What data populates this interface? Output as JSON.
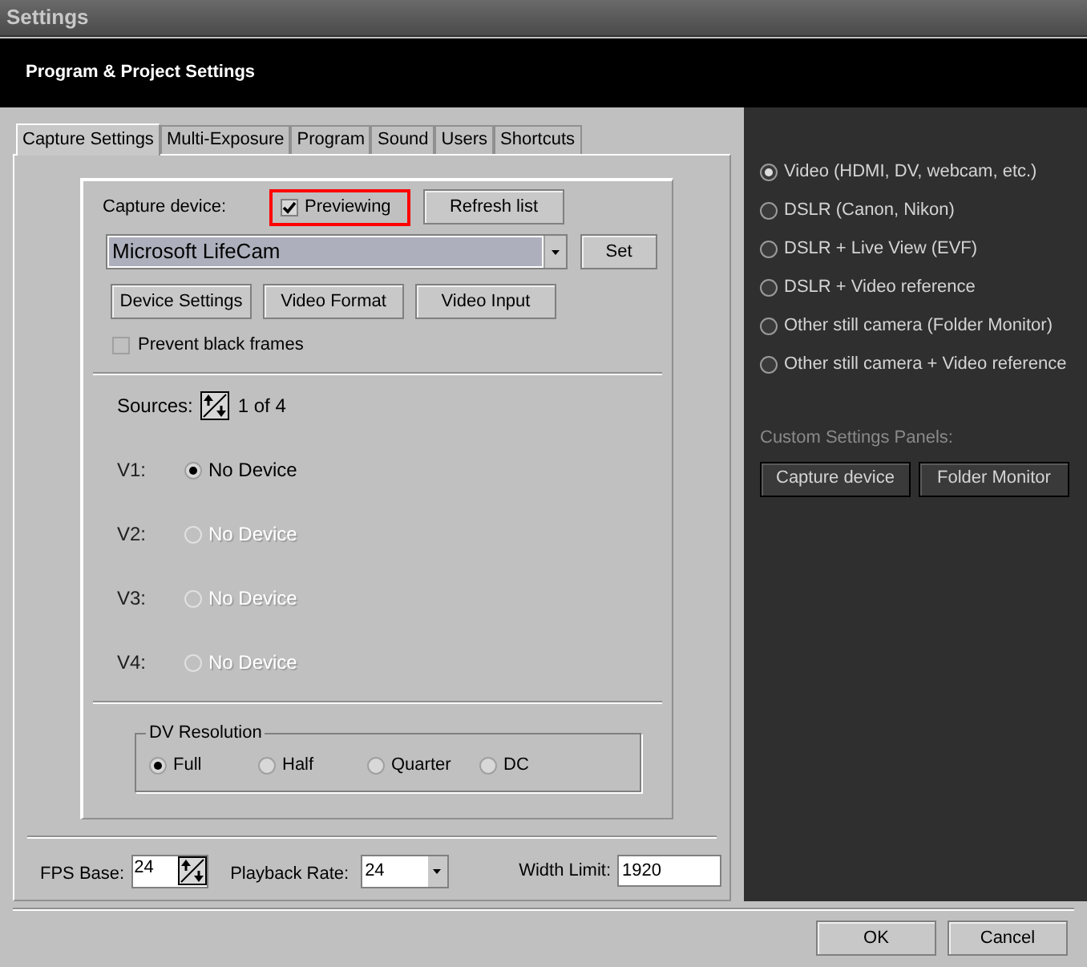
{
  "window": {
    "title": "Settings"
  },
  "header": {
    "title": "Program & Project Settings"
  },
  "tabs": [
    {
      "label": "Capture Settings",
      "selected": true
    },
    {
      "label": "Multi-Exposure",
      "selected": false
    },
    {
      "label": "Program",
      "selected": false
    },
    {
      "label": "Sound",
      "selected": false
    },
    {
      "label": "Users",
      "selected": false
    },
    {
      "label": "Shortcuts",
      "selected": false
    }
  ],
  "capture": {
    "label": "Capture device:",
    "previewing": {
      "label": "Previewing",
      "checked": true,
      "highlighted": true
    },
    "refresh_button": "Refresh list",
    "device": {
      "value": "Microsoft LifeCam"
    },
    "set_button": "Set",
    "buttons": [
      "Device Settings",
      "Video Format",
      "Video Input"
    ],
    "prevent_black_frames": {
      "label": "Prevent black frames",
      "checked": false
    }
  },
  "sources": {
    "label": "Sources:",
    "count": "1 of 4",
    "rows": [
      {
        "label": "V1:",
        "device": "No Device",
        "selected": true,
        "disabled": false
      },
      {
        "label": "V2:",
        "device": "No Device",
        "selected": false,
        "disabled": true
      },
      {
        "label": "V3:",
        "device": "No Device",
        "selected": false,
        "disabled": true
      },
      {
        "label": "V4:",
        "device": "No Device",
        "selected": false,
        "disabled": true
      }
    ]
  },
  "dv_resolution": {
    "title": "DV Resolution",
    "options": [
      {
        "label": "Full",
        "selected": true
      },
      {
        "label": "Half",
        "selected": false
      },
      {
        "label": "Quarter",
        "selected": false
      },
      {
        "label": "DC",
        "selected": false
      }
    ]
  },
  "fps_base": {
    "label": "FPS Base:",
    "value": "24"
  },
  "playback_rate": {
    "label": "Playback Rate:",
    "value": "24"
  },
  "width_limit": {
    "label": "Width Limit:",
    "value": "1920"
  },
  "camera_types": [
    {
      "label": "Video (HDMI, DV, webcam, etc.)",
      "selected": true
    },
    {
      "label": "DSLR (Canon, Nikon)",
      "selected": false
    },
    {
      "label": "DSLR + Live View (EVF)",
      "selected": false
    },
    {
      "label": "DSLR + Video reference",
      "selected": false
    },
    {
      "label": "Other still camera (Folder Monitor)",
      "selected": false
    },
    {
      "label": "Other still camera + Video reference",
      "selected": false
    }
  ],
  "custom_panels": {
    "label": "Custom Settings Panels:",
    "buttons": [
      "Capture device",
      "Folder Monitor"
    ]
  },
  "dialog_buttons": [
    "OK",
    "Cancel"
  ]
}
